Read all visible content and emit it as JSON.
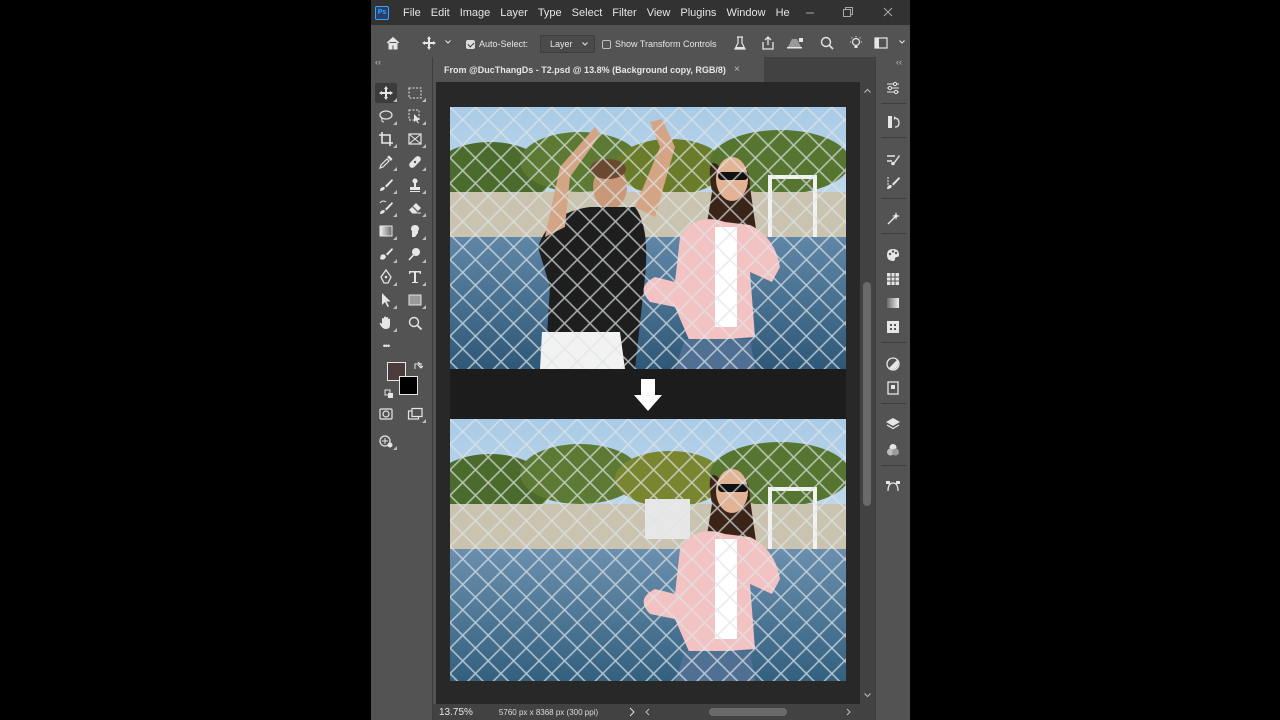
{
  "menubar": {
    "logo_text": "Ps",
    "items": [
      "File",
      "Edit",
      "Image",
      "Layer",
      "Type",
      "Select",
      "Filter",
      "View",
      "Plugins",
      "Window",
      "He"
    ]
  },
  "options_bar": {
    "auto_select_label": "Auto-Select:",
    "auto_select_checked": true,
    "auto_select_value": "Layer",
    "transform_controls_label": "Show Transform Controls",
    "transform_controls_checked": false
  },
  "document_tab": {
    "title": "From @DucThangDs - T2.psd @ 13.8% (Background copy, RGB/8)",
    "close_glyph": "×"
  },
  "toolbar": {
    "more_glyph": "•••",
    "foreground_color": "#4a3d3d",
    "background_color": "#000000"
  },
  "status_bar": {
    "zoom": "13.75%",
    "doc_info": "5760 px x 8368 px (300 ppi)"
  },
  "canvas": {
    "background": "#282828",
    "before_after_arrow": "down-arrow"
  },
  "colors": {
    "menu_bg": "#323232",
    "panel_bg": "#535353",
    "dark_bg": "#282828",
    "accent": "#31a8ff"
  }
}
